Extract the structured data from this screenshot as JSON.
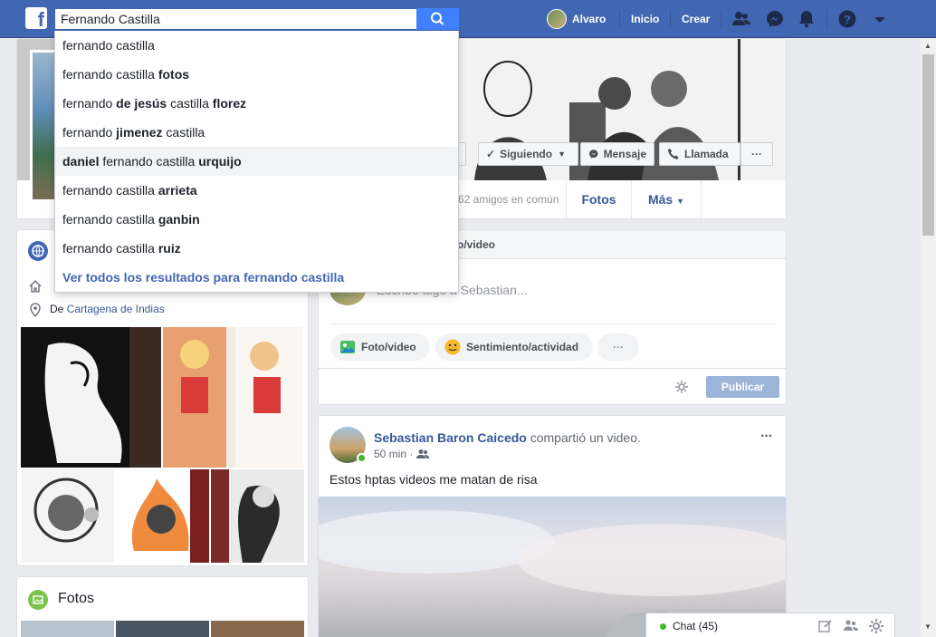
{
  "topbar": {
    "logo": "f",
    "search_value": "Fernando Castilla",
    "user_name": "Alvaro",
    "home_label": "Inicio",
    "create_label": "Crear"
  },
  "dropdown": {
    "items": [
      {
        "parts": [
          [
            "fernando castilla",
            false
          ]
        ]
      },
      {
        "parts": [
          [
            "fernando castilla ",
            false
          ],
          [
            "fotos",
            true
          ]
        ]
      },
      {
        "parts": [
          [
            "fernando ",
            false
          ],
          [
            "de jesús",
            true
          ],
          [
            " castilla ",
            false
          ],
          [
            "florez",
            true
          ]
        ]
      },
      {
        "parts": [
          [
            "fernando ",
            false
          ],
          [
            "jimenez",
            true
          ],
          [
            " castilla",
            false
          ]
        ]
      },
      {
        "parts": [
          [
            "daniel",
            true
          ],
          [
            " fernando castilla ",
            false
          ],
          [
            "urquijo",
            true
          ]
        ]
      },
      {
        "parts": [
          [
            "fernando castilla ",
            false
          ],
          [
            "arrieta",
            true
          ]
        ]
      },
      {
        "parts": [
          [
            "fernando castilla ",
            false
          ],
          [
            "ganbin",
            true
          ]
        ]
      },
      {
        "parts": [
          [
            "fernando castilla ",
            false
          ],
          [
            "ruiz",
            true
          ]
        ]
      }
    ],
    "see_all": "Ver todos los resultados para fernando castilla"
  },
  "cover": {
    "following_label": "Siguiendo",
    "message_label": "Mensaje",
    "call_label": "Llamada",
    "more_label": "···",
    "mutual_friends": "62 amigos en común",
    "tab_photos": "Fotos",
    "tab_more": "Más"
  },
  "intro": {
    "from_prefix": "De",
    "from_place": "Cartagena de Indias"
  },
  "photos_card": {
    "title": "Fotos"
  },
  "composer": {
    "tab_label": "to/video",
    "placeholder": "Escribe algo a Sebastian...",
    "photo_label": "Foto/video",
    "feeling_label": "Sentimiento/actividad",
    "more_label": "···",
    "publish_label": "Publicar"
  },
  "post": {
    "author": "Sebastian Baron Caicedo",
    "action": "compartió un video.",
    "time": "50 min ·",
    "text": "Estos hptas videos me matan de risa",
    "menu": "···"
  },
  "chat": {
    "label": "Chat (45)"
  },
  "colors": {
    "brand": "#4267b2",
    "link": "#365899",
    "online": "#42b72a"
  }
}
